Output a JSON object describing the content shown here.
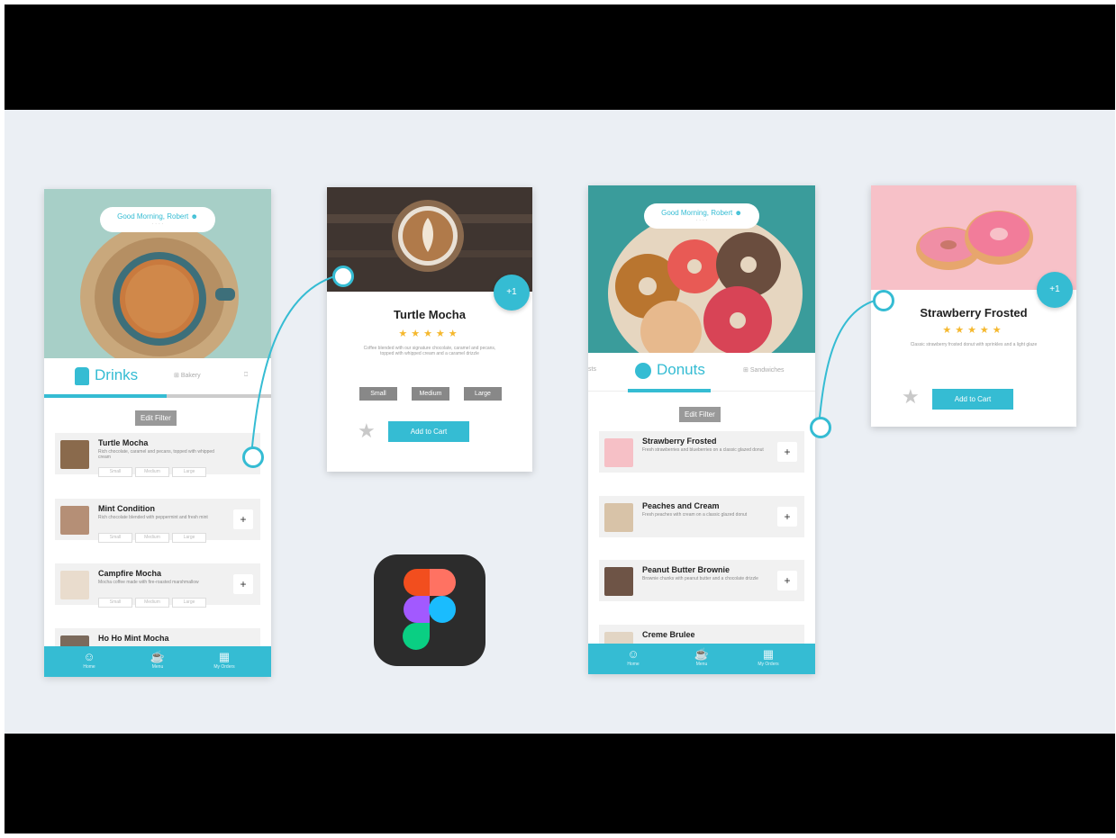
{
  "colors": {
    "accent": "#35bcd3",
    "star": "#f5b82e",
    "stage": "#ebeff4"
  },
  "drinks": {
    "greeting": "Good Morning, Robert ☻",
    "greeting_sub": "· · · ·",
    "tab_main": "Drinks",
    "tab_other": "Bakery",
    "filter_label": "Edit Filter",
    "items": [
      {
        "name": "Turtle Mocha",
        "desc": "Rich chocolate, caramel and pecans, topped with whipped cream",
        "pills": [
          "Small",
          "Medium",
          "Large"
        ],
        "add": "+"
      },
      {
        "name": "Mint Condition",
        "desc": "Rich chocolate blended with peppermint and fresh mint",
        "pills": [
          "Small",
          "Medium",
          "Large"
        ],
        "add": "+"
      },
      {
        "name": "Campfire Mocha",
        "desc": "Mocha coffee made with fire-roasted marshmallow",
        "pills": [
          "Small",
          "Medium",
          "Large"
        ],
        "add": "+"
      },
      {
        "name": "Ho Ho Mint Mocha",
        "desc": "",
        "pills": [],
        "add": ""
      }
    ],
    "nav": [
      {
        "icon": "☺",
        "label": "Home"
      },
      {
        "icon": "☕",
        "label": "Menu"
      },
      {
        "icon": "▦",
        "label": "My Orders"
      }
    ]
  },
  "drink_detail": {
    "title": "Turtle Mocha",
    "stars": "★★★★★",
    "description": "Coffee blended with our signature chocolate, caramel and pecans, topped with whipped cream and a caramel drizzle",
    "sizes": [
      "Small",
      "Medium",
      "Large"
    ],
    "add_to_cart": "Add to Cart",
    "badge": "+1"
  },
  "donuts": {
    "greeting": "Good Morning, Robert ☻",
    "greeting_sub": "· · · ·",
    "tab_main": "Donuts",
    "tab_left": "sts",
    "tab_other": "Sandwiches",
    "filter_label": "Edit Filter",
    "items": [
      {
        "name": "Strawberry Frosted",
        "desc": "Fresh strawberries and blueberries on a classic glazed donut",
        "add": "+"
      },
      {
        "name": "Peaches and Cream",
        "desc": "Fresh peaches with cream on a classic glazed donut",
        "add": "+"
      },
      {
        "name": "Peanut Butter Brownie",
        "desc": "Brownie chunks with peanut butter and a chocolate drizzle",
        "add": "+"
      },
      {
        "name": "Creme Brulee",
        "desc": "",
        "add": ""
      }
    ],
    "nav": [
      {
        "icon": "☺",
        "label": "Home"
      },
      {
        "icon": "☕",
        "label": "Menu"
      },
      {
        "icon": "▦",
        "label": "My Orders"
      }
    ]
  },
  "donut_detail": {
    "title": "Strawberry Frosted",
    "stars": "★★★★★",
    "description": "Classic strawberry frosted donut with sprinkles and a light glaze",
    "add_to_cart": "Add to Cart",
    "badge": "+1"
  }
}
